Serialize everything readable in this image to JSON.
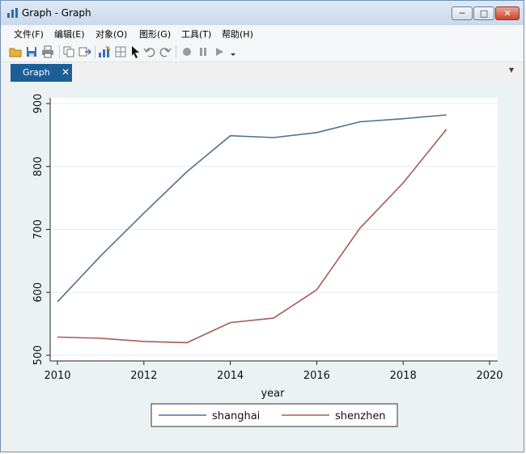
{
  "window": {
    "title": "Graph - Graph"
  },
  "titlebar_buttons": {
    "minimize": "─",
    "maximize": "□",
    "close": "✕"
  },
  "menu": [
    "文件(F)",
    "编辑(E)",
    "对象(O)",
    "图形(G)",
    "工具(T)",
    "帮助(H)"
  ],
  "toolbar_icons": [
    "open-folder-icon",
    "save-icon",
    "print-icon",
    "copy-icon",
    "export-icon",
    "graph-editor-icon",
    "grid-icon",
    "pointer-icon",
    "undo-icon",
    "redo-icon",
    "record-icon",
    "pause-icon",
    "play-icon",
    "dropdown-icon"
  ],
  "tabs": [
    {
      "label": "Graph",
      "close": "✕"
    }
  ],
  "colors": {
    "accent_tab": "#1c5f97",
    "shanghai": "#4e7190",
    "shenzhen": "#a55b57",
    "plot_bg": "#ffffff",
    "graph_bg": "#eaf2f3"
  },
  "chart_data": {
    "type": "line",
    "title": "",
    "xlabel": "year",
    "ylabel": "",
    "xlim": [
      2010,
      2020
    ],
    "ylim": [
      500,
      900
    ],
    "xticks": [
      2010,
      2012,
      2014,
      2016,
      2018,
      2020
    ],
    "yticks": [
      500,
      600,
      700,
      800,
      900
    ],
    "grid": true,
    "legend_position": "bottom",
    "series": [
      {
        "name": "shanghai",
        "color": "#4e7190",
        "x": [
          2010,
          2011,
          2012,
          2013,
          2014,
          2015,
          2016,
          2017,
          2018,
          2019
        ],
        "y": [
          585,
          658,
          726,
          792,
          849,
          846,
          854,
          871,
          876,
          882
        ]
      },
      {
        "name": "shenzhen",
        "color": "#a55b57",
        "x": [
          2010,
          2011,
          2012,
          2013,
          2014,
          2015,
          2016,
          2017,
          2018,
          2019
        ],
        "y": [
          529,
          527,
          522,
          520,
          552,
          559,
          604,
          702,
          774,
          859
        ]
      }
    ]
  }
}
